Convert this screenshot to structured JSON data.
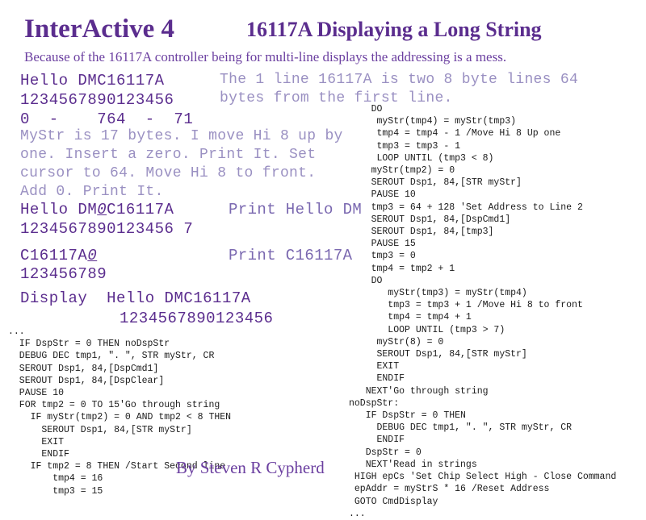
{
  "colors": {
    "accent": "#5b2d8e",
    "accent_soft": "#9a90c2",
    "accent_mid": "#7a68b0",
    "subtitle": "#6b3fa0",
    "code": "#1a1a1a",
    "background": "#ffffff"
  },
  "header": {
    "title": "InterActive 4",
    "subtitle": "16117A Displaying a Long String",
    "description": "Because of the 16117A controller being for multi-line displays the addressing is a mess."
  },
  "display": {
    "first_line_text": "Hello DMC16117A",
    "first_line_ruler": "1234567890123456",
    "address_row": "0  -    764  -  71",
    "note_right": "The 1 line 16117A is two 8 byte lines 64\nbytes from the first line.",
    "explanation": "MyStr is 17 bytes. I move Hi 8 up by\none. Insert a zero. Print It. Set\ncursor to 64. Move Hi 8 to front.\nAdd 0. Print It.",
    "second_line_prefix": "Hello DM",
    "second_line_inserted": "0",
    "second_line_suffix": "C16117A",
    "second_line_ruler": "1234567890123456 7",
    "second_line_ruler_plain": "1234567890123456 7",
    "print_label_1": "Print Hello DM",
    "third_line_prefix": "C16117A",
    "third_line_inserted": "0",
    "third_line_ruler": "123456789",
    "print_label_2": "Print C16117A",
    "display_label": "Display",
    "display_line_text": "Hello DMC16117A",
    "display_line_ruler": "1234567890123456"
  },
  "code_left": {
    "ellipsis_top": "...",
    "lines": "  IF DspStr = 0 THEN noDspStr\n  DEBUG DEC tmp1, \". \", STR myStr, CR\n  SEROUT Dsp1, 84,[DspCmd1]\n  SEROUT Dsp1, 84,[DspClear]\n  PAUSE 10\n  FOR tmp2 = 0 TO 15'Go through string\n    IF myStr(tmp2) = 0 AND tmp2 < 8 THEN\n      SEROUT Dsp1, 84,[STR myStr]\n      EXIT\n      ENDIF\n    IF tmp2 = 8 THEN /Start Second line\n        tmp4 = 16\n        tmp3 = 15"
  },
  "code_right": {
    "lines": "    DO\n     myStr(tmp4) = myStr(tmp3)\n     tmp4 = tmp4 - 1 /Move Hi 8 Up one\n     tmp3 = tmp3 - 1\n     LOOP UNTIL (tmp3 < 8)\n    myStr(tmp2) = 0\n    SEROUT Dsp1, 84,[STR myStr]\n    PAUSE 10\n    tmp3 = 64 + 128 'Set Address to Line 2\n    SEROUT Dsp1, 84,[DspCmd1]\n    SEROUT Dsp1, 84,[tmp3]\n    PAUSE 15\n    tmp3 = 0\n    tmp4 = tmp2 + 1\n    DO\n       myStr(tmp3) = myStr(tmp4)\n       tmp3 = tmp3 + 1 /Move Hi 8 to front\n       tmp4 = tmp4 + 1\n       LOOP UNTIL (tmp3 > 7)\n     myStr(8) = 0\n     SEROUT Dsp1, 84,[STR myStr]\n     EXIT\n     ENDIF\n   NEXT'Go through string\nnoDspStr:\n   IF DspStr = 0 THEN\n     DEBUG DEC tmp1, \". \", STR myStr, CR\n     ENDIF\n   DspStr = 0\n   NEXT'Read in strings\n HIGH epCs 'Set Chip Select High - Close Command\n epAddr = myStrS * 16 /Reset Address\n GOTO CmdDisplay\n..."
  },
  "footer": {
    "byline": "By Steven R Cypherd"
  }
}
